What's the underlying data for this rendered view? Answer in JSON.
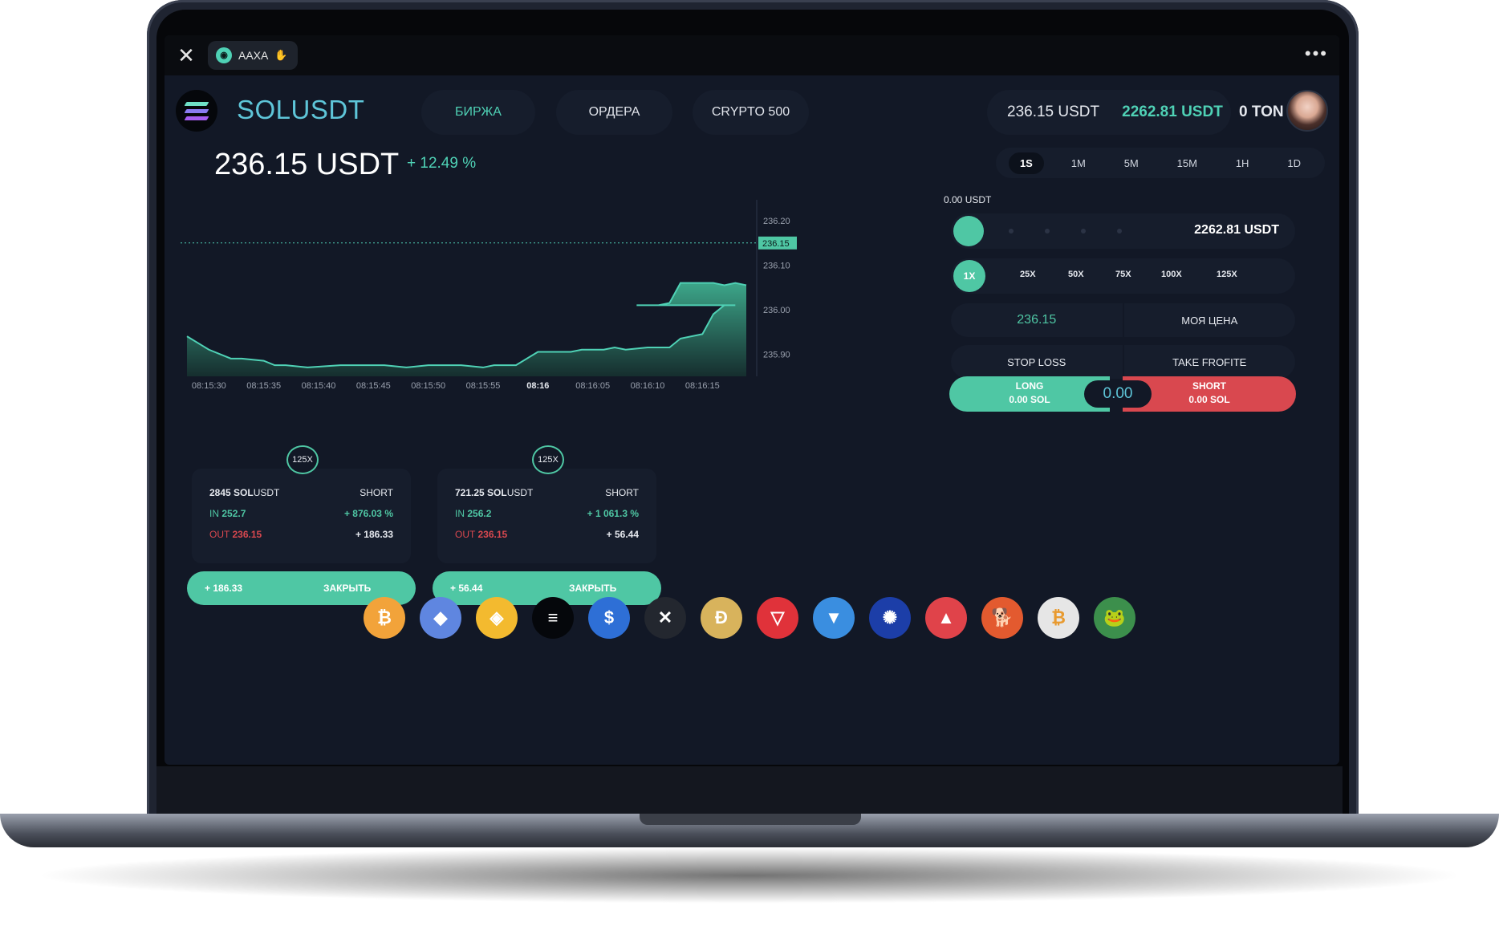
{
  "app": {
    "name": "AAXA",
    "close_glyph": "✕",
    "more_glyph": "•••"
  },
  "header": {
    "pair": "SOLUSDT",
    "nav": [
      {
        "label": "БИРЖА",
        "active": true
      },
      {
        "label": "ОРДЕРА"
      },
      {
        "label": "CRYPTO 500"
      }
    ],
    "balance_usdt": "236.15 USDT",
    "balance_total": "2262.81 USDT",
    "balance_ton": "0 TON"
  },
  "price": {
    "value": "236.15 USDT",
    "change": "+ 12.49 %"
  },
  "timeframes": [
    {
      "label": "1S",
      "active": true
    },
    {
      "label": "1M"
    },
    {
      "label": "5M"
    },
    {
      "label": "15M"
    },
    {
      "label": "1H"
    },
    {
      "label": "1D"
    }
  ],
  "chart_data": {
    "type": "area",
    "x": [
      "08:15:28",
      "08:15:30",
      "08:15:32",
      "08:15:33",
      "08:15:35",
      "08:15:36",
      "08:15:37",
      "08:15:39",
      "08:15:42",
      "08:15:45",
      "08:15:46",
      "08:15:48",
      "08:15:50",
      "08:15:51",
      "08:15:53",
      "08:15:55",
      "08:15:56",
      "08:15:58",
      "08:16:00",
      "08:16:02",
      "08:16:03",
      "08:16:04",
      "08:16:06",
      "08:16:07",
      "08:16:08",
      "08:16:10",
      "08:16:12",
      "08:16:13",
      "08:16:15",
      "08:16:16",
      "08:16:17",
      "08:16:18"
    ],
    "y": [
      235.94,
      235.91,
      235.89,
      235.89,
      235.885,
      235.875,
      235.875,
      235.87,
      235.875,
      235.875,
      235.875,
      235.87,
      235.875,
      235.875,
      235.875,
      235.87,
      235.875,
      235.875,
      235.905,
      235.905,
      235.905,
      235.91,
      235.91,
      235.915,
      235.91,
      235.915,
      235.915,
      235.935,
      235.945,
      235.99,
      236.01,
      236.01
    ],
    "y_tail": [
      236.01,
      236.01,
      236.015,
      236.06,
      236.06,
      236.06,
      236.055,
      236.06,
      236.055
    ],
    "x_tail": [
      "08:16:09",
      "08:16:11",
      "08:16:12",
      "08:16:13",
      "08:16:14",
      "08:16:16",
      "08:16:17",
      "08:16:18",
      "08:16:19"
    ],
    "xticks": [
      {
        "label": "08:15:30",
        "bold": false
      },
      {
        "label": "08:15:35",
        "bold": false
      },
      {
        "label": "08:15:40",
        "bold": false
      },
      {
        "label": "08:15:45",
        "bold": false
      },
      {
        "label": "08:15:50",
        "bold": false
      },
      {
        "label": "08:15:55",
        "bold": false
      },
      {
        "label": "08:16",
        "bold": true
      },
      {
        "label": "08:16:05",
        "bold": false
      },
      {
        "label": "08:16:10",
        "bold": false
      },
      {
        "label": "08:16:15",
        "bold": false
      }
    ],
    "yticks": [
      "236.20",
      "236.10",
      "236.00",
      "235.90"
    ],
    "ylim": [
      235.85,
      236.22
    ],
    "current": "236.15",
    "current_value": 236.15,
    "line_color": "#4fd1b5"
  },
  "trade": {
    "amount_label": "0.00 USDT",
    "slider_value": "2262.81 USDT",
    "leverage": [
      {
        "label": "1X",
        "active": true
      },
      {
        "label": "25X"
      },
      {
        "label": "50X"
      },
      {
        "label": "75X"
      },
      {
        "label": "100X"
      },
      {
        "label": "125X"
      }
    ],
    "price_value": "236.15",
    "my_price": "МОЯ ЦЕНА",
    "stop_loss": "STOP LOSS",
    "take_profit": "TAKE FROFITE",
    "long_label": "LONG",
    "long_amount": "0.00 SOL",
    "short_label": "SHORT",
    "short_amount": "0.00 SOL",
    "center_value": "0.00"
  },
  "positions": [
    {
      "leverage": "125X",
      "amount": "2845",
      "asset_bold": "SOL",
      "asset_rest": "USDT",
      "side": "SHORT",
      "in_label": "IN",
      "in_value": "252.7",
      "in_pct": "+ 876.03 %",
      "out_label": "OUT",
      "out_value": "236.15",
      "out_pnl": "+ 186.33",
      "btn_pnl": "+ 186.33",
      "btn_label": "ЗАКРЫТЬ"
    },
    {
      "leverage": "125X",
      "amount": "721.25",
      "asset_bold": "SOL",
      "asset_rest": "USDT",
      "side": "SHORT",
      "in_label": "IN",
      "in_value": "256.2",
      "in_pct": "+ 1 061.3 %",
      "out_label": "OUT",
      "out_value": "236.15",
      "out_pnl": "+ 56.44",
      "btn_pnl": "+ 56.44",
      "btn_label": "ЗАКРЫТЬ"
    }
  ],
  "coins": [
    {
      "icon": "bitcoin-icon",
      "glyph": "₿",
      "color": "#f2a33a"
    },
    {
      "icon": "ethereum-icon",
      "glyph": "◆",
      "color": "#5f86e0"
    },
    {
      "icon": "bnb-icon",
      "glyph": "◈",
      "color": "#f3ba2f"
    },
    {
      "icon": "solana-icon",
      "glyph": "≡",
      "color": "#05070b"
    },
    {
      "icon": "usdc-icon",
      "glyph": "$",
      "color": "#2e6fd6"
    },
    {
      "icon": "xrp-icon",
      "glyph": "✕",
      "color": "#23272f"
    },
    {
      "icon": "dogecoin-icon",
      "glyph": "Ð",
      "color": "#d8b35c"
    },
    {
      "icon": "tron-icon",
      "glyph": "▽",
      "color": "#e0323a"
    },
    {
      "icon": "toncoin-icon",
      "glyph": "▼",
      "color": "#3a8ee0"
    },
    {
      "icon": "cardano-icon",
      "glyph": "✺",
      "color": "#1c3ea8"
    },
    {
      "icon": "avalanche-icon",
      "glyph": "▲",
      "color": "#e0434a"
    },
    {
      "icon": "shiba-inu-icon",
      "glyph": "🐕",
      "color": "#e35a2f"
    },
    {
      "icon": "wrapped-bitcoin-icon",
      "glyph": "₿",
      "color": "#e6e6e6"
    },
    {
      "icon": "pepe-icon",
      "glyph": "🐸",
      "color": "#3c8f4c"
    }
  ]
}
